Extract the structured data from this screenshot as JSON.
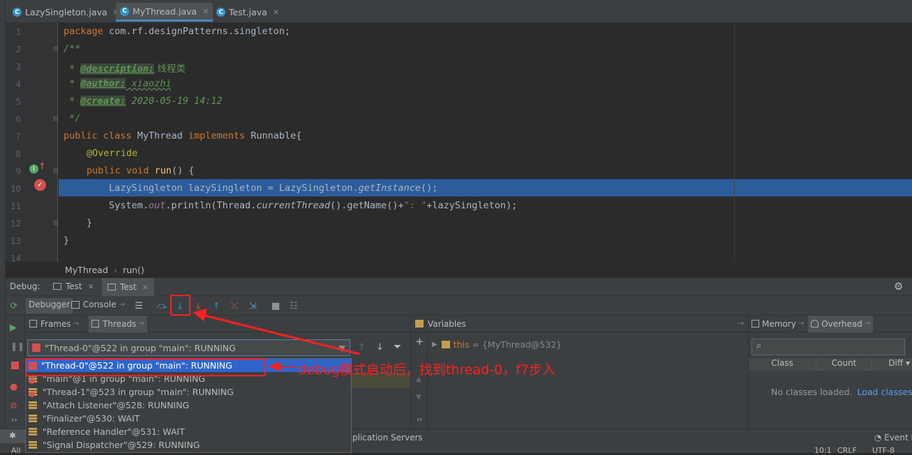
{
  "tabs": [
    {
      "label": "LazySingleton.java",
      "active": false
    },
    {
      "label": "MyThread.java",
      "active": true
    },
    {
      "label": "Test.java",
      "active": false
    }
  ],
  "editor": {
    "line_numbers": [
      "1",
      "2",
      "3",
      "4",
      "5",
      "6",
      "7",
      "8",
      "9",
      "10",
      "11",
      "12",
      "13",
      "14"
    ],
    "line1": {
      "kw": "package",
      "rest": " com.rf.designPatterns.singleton;"
    },
    "line2": "/**",
    "line3": {
      "prefix": " * ",
      "tag": "@description:",
      "text": " 线程类"
    },
    "line4": {
      "prefix": " * ",
      "tag": "@author:",
      "text": " xiaozhi"
    },
    "line5": {
      "prefix": " * ",
      "tag": "@create:",
      "text": " 2020-05-19 14:12"
    },
    "line6": " */",
    "line7": {
      "kw1": "public class",
      "name": " MyThread ",
      "kw2": "implements",
      "rest": " Runnable{"
    },
    "line8": "@Override",
    "line9": {
      "kw": "public void",
      "fn": " run",
      "rest": "() {"
    },
    "line10": {
      "a": "LazySingleton lazySingleton = LazySingleton.",
      "b": "getInstance",
      "c": "();"
    },
    "line11": {
      "a": "System.",
      "b": "out",
      "c": ".println(Thread.",
      "d": "currentThread",
      "e": "().getName()+",
      "f": "\": \"",
      "g": "+lazySingleton);"
    },
    "line12": "}",
    "line13": "}"
  },
  "breadcrumb": {
    "class": "MyThread",
    "method": "run()"
  },
  "debug": {
    "title": "Debug:",
    "tabs": [
      "Test",
      "Test"
    ],
    "debugger_tab": "Debugger",
    "console_tab": "Console",
    "frames_tab": "Frames",
    "threads_tab": "Threads",
    "variables_label": "Variables",
    "memory_label": "Memory",
    "overhead_label": "Overhead",
    "thread_selector": "\"Thread-0\"@522 in group \"main\": RUNNING",
    "variable": {
      "name": "this",
      "value": "= {MyThread@532}"
    },
    "memory_columns": [
      "Class",
      "Count",
      "Diff"
    ],
    "no_classes": "No classes loaded.",
    "load_classes": "Load classes"
  },
  "threads": [
    {
      "label": "\"Thread-0\"@522 in group \"main\": RUNNING",
      "selected": true
    },
    {
      "label": "\"main\"@1 in group \"main\": RUNNING",
      "selected": false
    },
    {
      "label": "\"Thread-1\"@523 in group \"main\": RUNNING",
      "selected": false
    },
    {
      "label": "\"Attach Listener\"@528: RUNNING",
      "selected": false
    },
    {
      "label": "\"Finalizer\"@530: WAIT",
      "selected": false
    },
    {
      "label": "\"Reference Handler\"@531: WAIT",
      "selected": false
    },
    {
      "label": "\"Signal Dispatcher\"@529: RUNNING",
      "selected": false
    }
  ],
  "annotation": "debug模式启动后，找到thread-0，f7步入",
  "status": {
    "app_servers": "plication Servers",
    "event_log": "Event L",
    "position": "10:1",
    "line_sep": "CRLF",
    "encoding": "UTF-8",
    "all_files": "All"
  },
  "colors": {
    "accent": "#4a88c7",
    "selection": "#2d5c9a",
    "annotation": "#ff2020"
  }
}
